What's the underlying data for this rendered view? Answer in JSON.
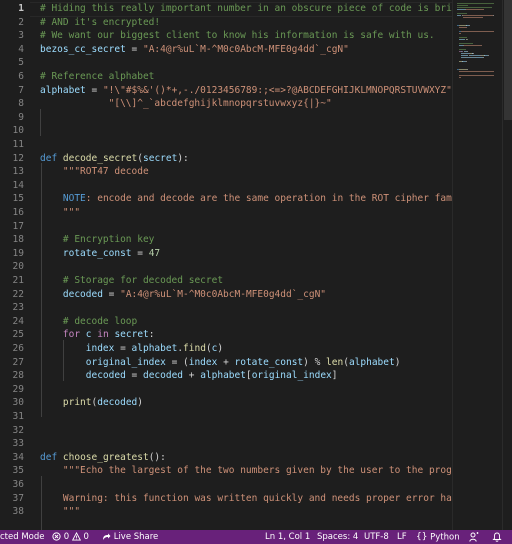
{
  "editor": {
    "current_line": 1,
    "line_numbers": [
      "1",
      "2",
      "3",
      "4",
      "5",
      "6",
      "7",
      "8",
      "9",
      "10",
      "11",
      "12",
      "13",
      "14",
      "15",
      "16",
      "17",
      "18",
      "19",
      "20",
      "21",
      "22",
      "23",
      "24",
      "25",
      "26",
      "27",
      "28",
      "29",
      "30",
      "31",
      "32",
      "33",
      "34",
      "35",
      "36",
      "37",
      "38"
    ],
    "lines": [
      [
        [
          "# Hiding this really important number in an obscure piece of code is brill",
          "comment"
        ]
      ],
      [
        [
          "# AND it's encrypted!",
          "comment"
        ]
      ],
      [
        [
          "# We want our biggest client to know his information is safe with us.",
          "comment"
        ]
      ],
      [
        [
          "bezos_cc_secret",
          "var"
        ],
        [
          " = ",
          "op"
        ],
        [
          "\"A:4@r%uL`M-^M0c0AbcM-MFE0g4dd`_cgN\"",
          "str"
        ]
      ],
      [],
      [
        [
          "# Reference alphabet",
          "comment"
        ]
      ],
      [
        [
          "alphabet",
          "var"
        ],
        [
          " = ",
          "op"
        ],
        [
          "\"!\\\"#$%&'()*+,-./0123456789:;<=>?@ABCDEFGHIJKLMNOPQRSTUVWXYZ\"",
          "str"
        ],
        [
          "+",
          "op"
        ]
      ],
      [
        [
          "            ",
          "plain"
        ],
        [
          "\"[\\\\]^_`abcdefghijklmnopqrstuvwxyz{|}~\"",
          "str"
        ]
      ],
      [],
      [],
      [],
      [
        [
          "def",
          "kw"
        ],
        [
          " ",
          "plain"
        ],
        [
          "decode_secret",
          "fn"
        ],
        [
          "(",
          "plain"
        ],
        [
          "secret",
          "var"
        ],
        [
          "):",
          "plain"
        ]
      ],
      [
        [
          "    ",
          "plain"
        ],
        [
          "\"\"\"ROT47 decode",
          "str"
        ]
      ],
      [],
      [
        [
          "    ",
          "plain"
        ],
        [
          "NOTE",
          "note"
        ],
        [
          ": encode and decode are the same operation in the ROT cipher famil",
          "str"
        ]
      ],
      [
        [
          "    ",
          "plain"
        ],
        [
          "\"\"\"",
          "str"
        ]
      ],
      [],
      [
        [
          "    ",
          "plain"
        ],
        [
          "# Encryption key",
          "comment"
        ]
      ],
      [
        [
          "    ",
          "plain"
        ],
        [
          "rotate_const",
          "var"
        ],
        [
          " = ",
          "op"
        ],
        [
          "47",
          "num"
        ]
      ],
      [],
      [
        [
          "    ",
          "plain"
        ],
        [
          "# Storage for decoded secret",
          "comment"
        ]
      ],
      [
        [
          "    ",
          "plain"
        ],
        [
          "decoded",
          "var"
        ],
        [
          " = ",
          "op"
        ],
        [
          "\"A:4@r%uL`M-^M0c0AbcM-MFE0g4dd`_cgN\"",
          "str"
        ]
      ],
      [],
      [
        [
          "    ",
          "plain"
        ],
        [
          "# decode loop",
          "comment"
        ]
      ],
      [
        [
          "    ",
          "plain"
        ],
        [
          "for",
          "ctrl"
        ],
        [
          " ",
          "plain"
        ],
        [
          "c",
          "var"
        ],
        [
          " ",
          "plain"
        ],
        [
          "in",
          "ctrl"
        ],
        [
          " ",
          "plain"
        ],
        [
          "secret",
          "var"
        ],
        [
          ":",
          "plain"
        ]
      ],
      [
        [
          "        ",
          "plain"
        ],
        [
          "index",
          "var"
        ],
        [
          " = ",
          "op"
        ],
        [
          "alphabet",
          "var"
        ],
        [
          ".",
          "plain"
        ],
        [
          "find",
          "fn"
        ],
        [
          "(",
          "plain"
        ],
        [
          "c",
          "var"
        ],
        [
          ")",
          "plain"
        ]
      ],
      [
        [
          "        ",
          "plain"
        ],
        [
          "original_index",
          "var"
        ],
        [
          " = (",
          "op"
        ],
        [
          "index",
          "var"
        ],
        [
          " + ",
          "op"
        ],
        [
          "rotate_const",
          "var"
        ],
        [
          ") % ",
          "op"
        ],
        [
          "len",
          "fn"
        ],
        [
          "(",
          "plain"
        ],
        [
          "alphabet",
          "var"
        ],
        [
          ")",
          "plain"
        ]
      ],
      [
        [
          "        ",
          "plain"
        ],
        [
          "decoded",
          "var"
        ],
        [
          " = ",
          "op"
        ],
        [
          "decoded",
          "var"
        ],
        [
          " + ",
          "op"
        ],
        [
          "alphabet",
          "var"
        ],
        [
          "[",
          "plain"
        ],
        [
          "original_index",
          "var"
        ],
        [
          "]",
          "plain"
        ]
      ],
      [],
      [
        [
          "    ",
          "plain"
        ],
        [
          "print",
          "fn"
        ],
        [
          "(",
          "plain"
        ],
        [
          "decoded",
          "var"
        ],
        [
          ")",
          "plain"
        ]
      ],
      [],
      [],
      [],
      [
        [
          "def",
          "kw"
        ],
        [
          " ",
          "plain"
        ],
        [
          "choose_greatest",
          "fn"
        ],
        [
          "():",
          "plain"
        ]
      ],
      [
        [
          "    ",
          "plain"
        ],
        [
          "\"\"\"Echo the largest of the two numbers given by the user to the progra",
          "str"
        ]
      ],
      [],
      [
        [
          "    ",
          "plain"
        ],
        [
          "Warning: this function was written quickly and needs proper error hand",
          "str"
        ]
      ],
      [
        [
          "    ",
          "plain"
        ],
        [
          "\"\"\"",
          "str"
        ]
      ]
    ]
  },
  "statusbar": {
    "mode": "cted Mode",
    "errors": "0",
    "warnings": "0",
    "live_share": "Live Share",
    "cursor": "Ln 1, Col 1",
    "spaces": "Spaces: 4",
    "encoding": "UTF-8",
    "eol": "LF",
    "language": "Python"
  },
  "icons": {
    "error": "error-circle-icon",
    "warning": "warning-triangle-icon",
    "live_share": "live-share-icon",
    "language_mode": "python-braces-icon",
    "feedback": "feedback-person-icon",
    "notifications": "bell-icon"
  },
  "colors": {
    "background": "#1e1e1e",
    "statusbar": "#68217a",
    "comment": "#6a9955",
    "variable": "#9cdcfe",
    "string": "#ce9178",
    "keyword": "#569cd6",
    "control": "#c586c0",
    "function": "#dcdcaa",
    "number": "#b5cea8"
  }
}
